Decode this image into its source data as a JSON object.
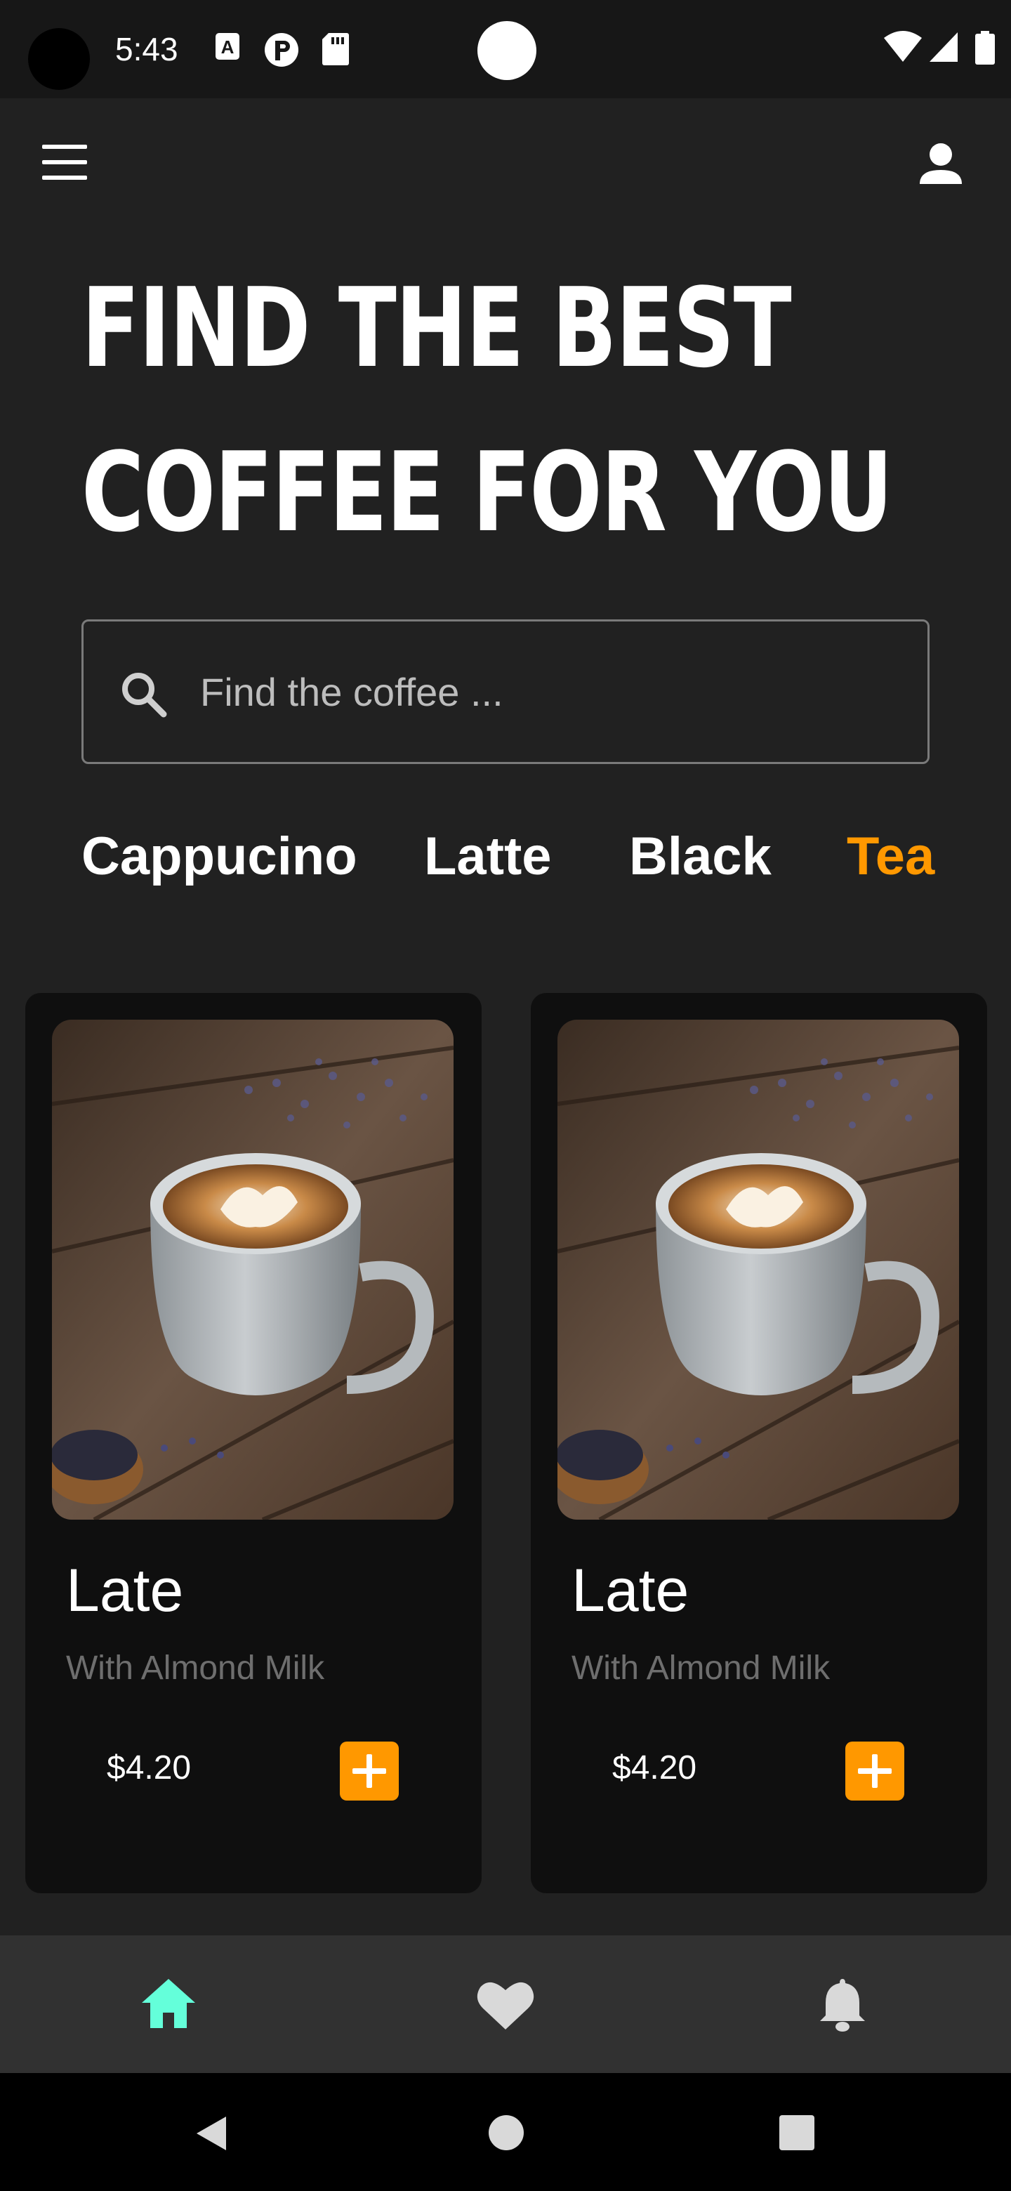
{
  "status_bar": {
    "time": "5:43",
    "notification_icons": [
      "a-box-icon",
      "p-circle-icon",
      "sd-card-icon"
    ],
    "system_icons": [
      "wifi-icon",
      "signal-icon",
      "battery-icon"
    ]
  },
  "app_bar": {
    "menu_icon": "hamburger-menu-icon",
    "profile_icon": "person-icon"
  },
  "headline": {
    "line1": "FIND THE BEST",
    "line2": "COFFEE FOR YOU"
  },
  "search": {
    "placeholder": "Find the coffee ...",
    "icon": "search-icon"
  },
  "tabs": [
    {
      "label": "Cappucino",
      "active": false
    },
    {
      "label": "Latte",
      "active": false
    },
    {
      "label": "Black",
      "active": false
    },
    {
      "label": "Tea",
      "active": true
    }
  ],
  "products": [
    {
      "name": "Late",
      "subtitle": "With Almond Milk",
      "price": "$4.20",
      "image": "latte-art-cup-photo"
    },
    {
      "name": "Late",
      "subtitle": "With Almond Milk",
      "price": "$4.20",
      "image": "latte-art-cup-photo"
    }
  ],
  "bottom_nav": [
    {
      "icon": "home-icon",
      "active": true
    },
    {
      "icon": "heart-icon",
      "active": false
    },
    {
      "icon": "bell-icon",
      "active": false
    }
  ],
  "system_nav": [
    "back-icon",
    "home-circle-icon",
    "recents-icon"
  ],
  "colors": {
    "background": "#212121",
    "accent": "#ff9800",
    "nav_active": "#64ffda",
    "card": "#0f0f0f"
  }
}
